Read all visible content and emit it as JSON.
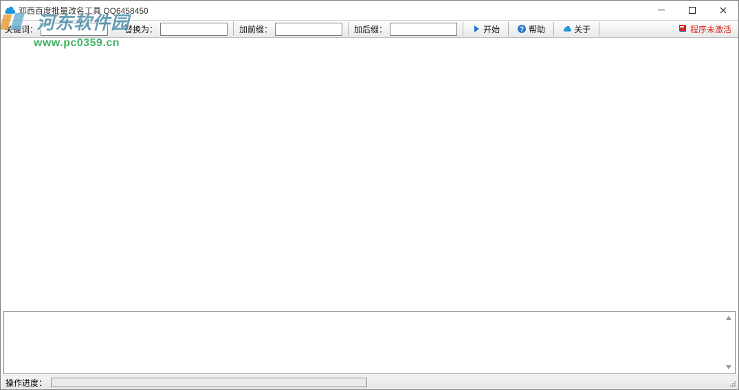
{
  "window": {
    "title": "邓西百度批量改名工具  QQ6458450"
  },
  "toolbar": {
    "keyword_label": "关键词：",
    "keyword_value": "",
    "replace_label": "替换为：",
    "replace_value": "",
    "prefix_label": "加前缀：",
    "prefix_value": "",
    "suffix_label": "加后缀：",
    "suffix_value": "",
    "start_label": "开始",
    "help_label": "帮助",
    "about_label": "关于",
    "status_label": "程序未激活"
  },
  "statusbar": {
    "progress_label": "操作进度："
  },
  "watermark": {
    "line1": "河东软件园",
    "line2": "www.pc0359.cn"
  },
  "colors": {
    "accent_blue": "#1b76d1",
    "cloud_blue": "#1f9ad6",
    "danger_red": "#d8261c",
    "help_blue": "#2b78c4"
  }
}
